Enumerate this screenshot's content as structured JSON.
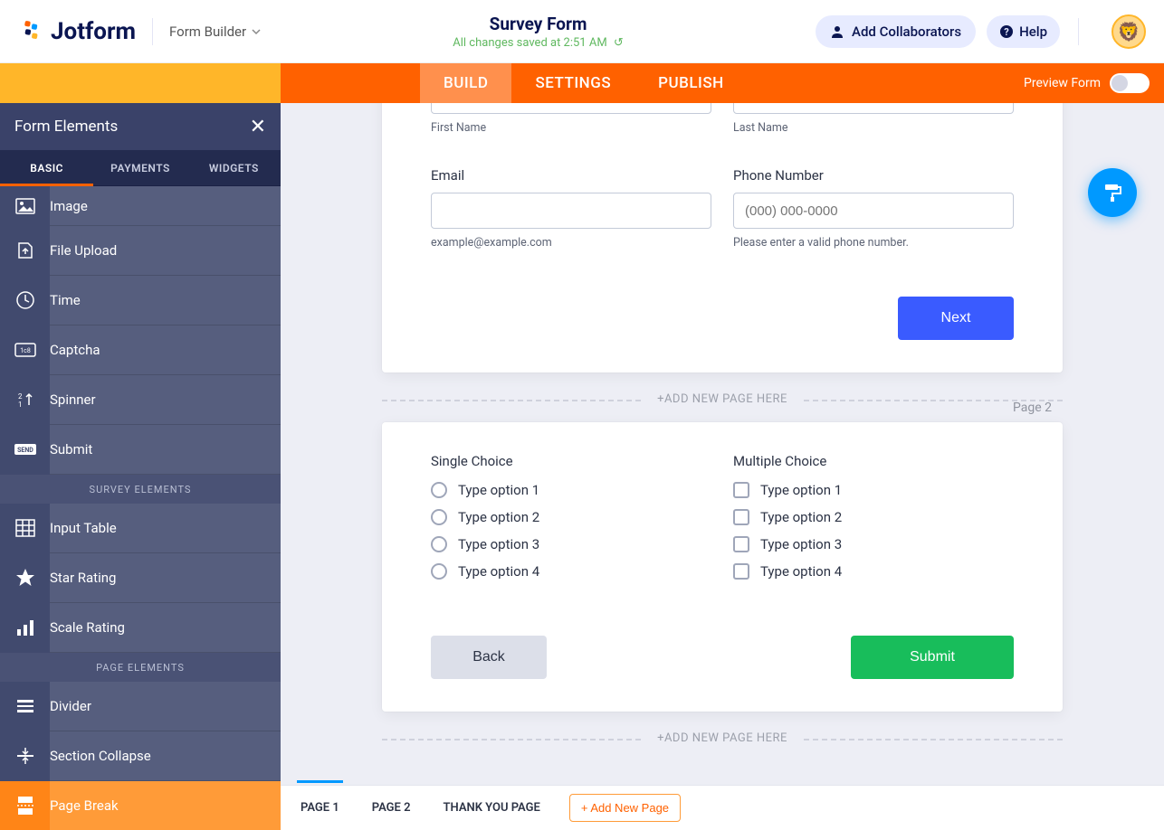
{
  "header": {
    "brand": "Jotform",
    "mode_label": "Form Builder",
    "title": "Survey Form",
    "save_status": "All changes saved at 2:51 AM",
    "collab_label": "Add Collaborators",
    "help_label": "Help"
  },
  "tabs": {
    "build": "BUILD",
    "settings": "SETTINGS",
    "publish": "PUBLISH",
    "preview_label": "Preview Form"
  },
  "sidebar": {
    "title": "Form Elements",
    "tabs": {
      "basic": "BASIC",
      "payments": "PAYMENTS",
      "widgets": "WIDGETS"
    },
    "items": [
      {
        "label": "Image",
        "icon": "image-icon"
      },
      {
        "label": "File Upload",
        "icon": "file-upload-icon"
      },
      {
        "label": "Time",
        "icon": "clock-icon"
      },
      {
        "label": "Captcha",
        "icon": "captcha-icon"
      },
      {
        "label": "Spinner",
        "icon": "spinner-icon"
      },
      {
        "label": "Submit",
        "icon": "send-icon"
      }
    ],
    "sections": {
      "survey": "SURVEY ELEMENTS",
      "page": "PAGE ELEMENTS"
    },
    "survey_items": [
      {
        "label": "Input Table",
        "icon": "grid-icon"
      },
      {
        "label": "Star Rating",
        "icon": "star-icon"
      },
      {
        "label": "Scale Rating",
        "icon": "bars-icon"
      }
    ],
    "page_items": [
      {
        "label": "Divider",
        "icon": "divider-icon"
      },
      {
        "label": "Section Collapse",
        "icon": "collapse-icon"
      },
      {
        "label": "Page Break",
        "icon": "pagebreak-icon",
        "selected": true
      }
    ]
  },
  "form": {
    "first_name_sub": "First Name",
    "last_name_sub": "Last Name",
    "email_label": "Email",
    "email_sub": "example@example.com",
    "phone_label": "Phone Number",
    "phone_placeholder": "(000) 000-0000",
    "phone_sub": "Please enter a valid phone number.",
    "next_btn": "Next",
    "add_page": "+ADD NEW PAGE HERE",
    "page2_label": "Page 2",
    "single_label": "Single Choice",
    "multiple_label": "Multiple Choice",
    "options": [
      "Type option 1",
      "Type option 2",
      "Type option 3",
      "Type option 4"
    ],
    "back_btn": "Back",
    "submit_btn": "Submit"
  },
  "pagebar": {
    "p1": "PAGE 1",
    "p2": "PAGE 2",
    "ty": "THANK YOU PAGE",
    "add": "+ Add New Page"
  }
}
